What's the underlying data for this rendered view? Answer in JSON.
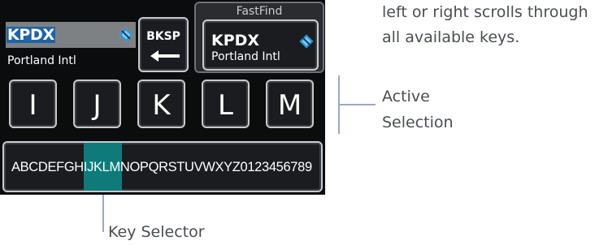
{
  "display": {
    "identifier_field": {
      "value": "KPDX",
      "name": "Portland Intl"
    },
    "backspace_label": "BKSP",
    "fastfind": {
      "title": "FastFind",
      "code": "KPDX",
      "name": "Portland Intl"
    },
    "keys": [
      "I",
      "J",
      "K",
      "L",
      "M"
    ],
    "key_selector": {
      "text": "ABCDEFGHIJKLMNOPQRSTUVWXYZ0123456789",
      "highlighted": "IJKLM"
    }
  },
  "callouts": {
    "top_right_line1": "left or right scrolls through",
    "top_right_line2": "all available keys.",
    "active_selection_line1": "Active",
    "active_selection_line2": "Selection",
    "key_selector": "Key Selector"
  },
  "colors": {
    "screen_bg": "#0b0c0e",
    "identifier_highlight": "#1f63a8",
    "selector_highlight": "#0f7a7a",
    "callout_line": "#9ba9c4"
  },
  "icons": [
    "waypoint-diamond-icon",
    "backspace-arrow-icon"
  ]
}
